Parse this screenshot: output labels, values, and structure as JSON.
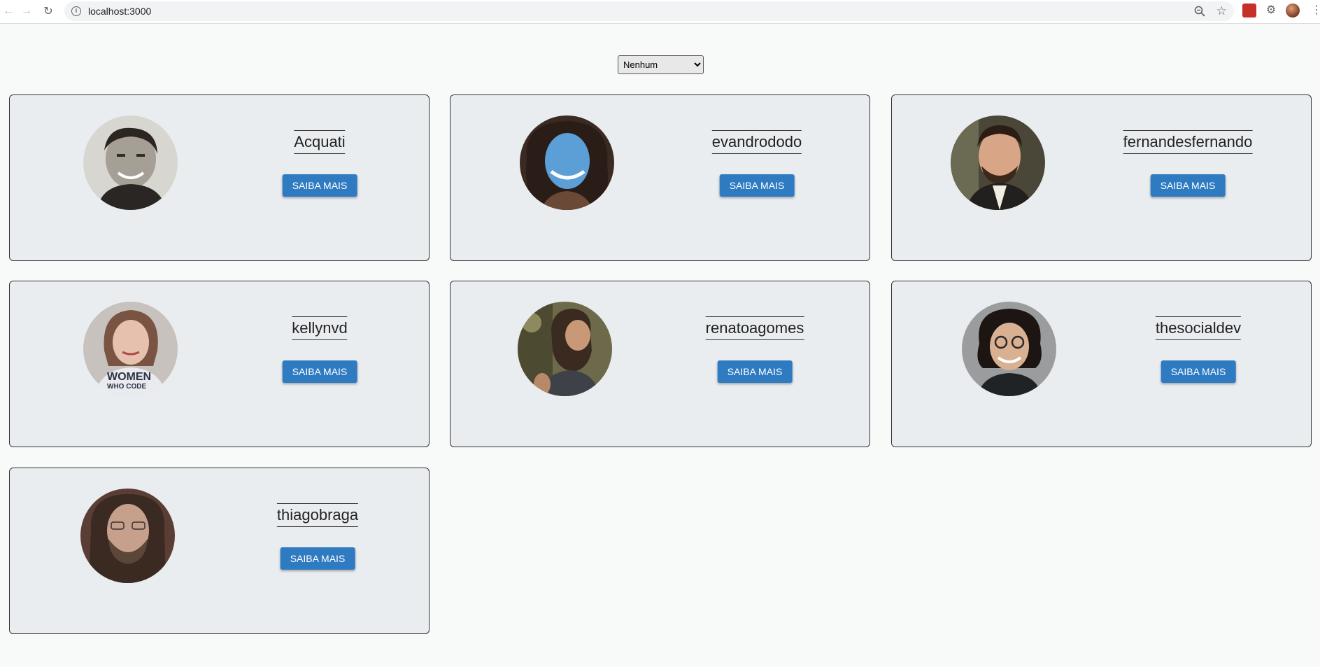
{
  "browser": {
    "url": "localhost:3000",
    "back_icon": "arrow-left-icon",
    "forward_icon": "arrow-right-icon",
    "reload_icon": "reload-icon"
  },
  "filter": {
    "selected": "Nenhum",
    "options": [
      "Nenhum"
    ]
  },
  "button_label": "SAIBA MAIS",
  "users": [
    {
      "name": "Acquati"
    },
    {
      "name": "evandrododo"
    },
    {
      "name": "fernandesfernando"
    },
    {
      "name": "kellynvd"
    },
    {
      "name": "renatoagomes"
    },
    {
      "name": "thesocialdev"
    },
    {
      "name": "thiagobraga"
    }
  ],
  "colors": {
    "button": "#2f7bc2",
    "card_bg": "#eaedf0",
    "page_bg": "#f8f9f9"
  }
}
